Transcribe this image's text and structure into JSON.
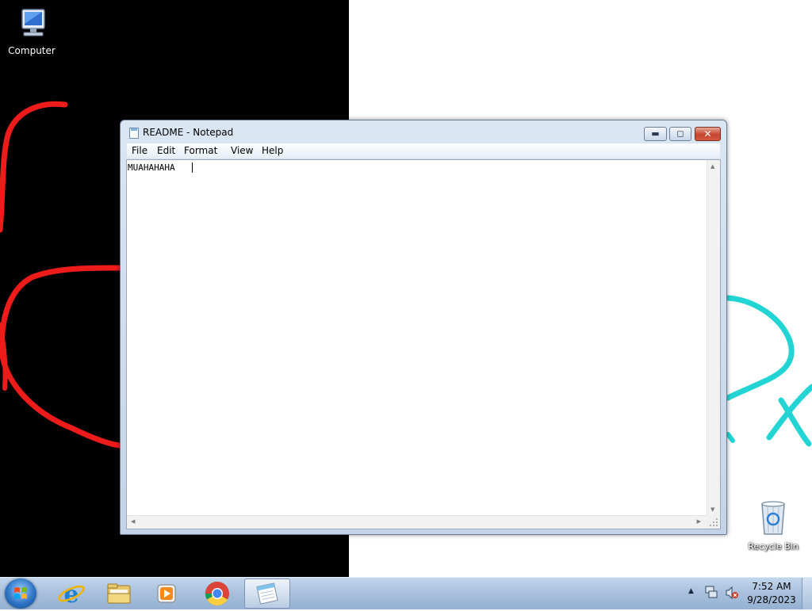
{
  "desktop": {
    "icons": [
      {
        "label": "Computer"
      },
      {
        "label": "Recycle Bin"
      }
    ],
    "colors": {
      "left_background": "#000000",
      "right_background": "#ffffff",
      "red_doodle": "#ee1b1b",
      "cyan_doodle": "#22d4d4"
    }
  },
  "notepad": {
    "title": "README - Notepad",
    "menu": [
      "File",
      "Edit",
      "Format",
      "View",
      "Help"
    ],
    "content": "MUAHAHAHA",
    "controls": {
      "minimize_icon": "minimize-icon",
      "maximize_icon": "maximize-icon",
      "close_icon": "close-icon",
      "close_glyph": "✕"
    }
  },
  "taskbar": {
    "start_icon": "windows-logo-icon",
    "pinned": [
      {
        "icon": "internet-explorer-icon"
      },
      {
        "icon": "folder-icon"
      },
      {
        "icon": "media-player-icon"
      },
      {
        "icon": "chrome-icon"
      },
      {
        "icon": "notepad-icon",
        "active": true
      }
    ],
    "tray": {
      "chevron": "▲",
      "network_icon": "network-icon",
      "volume_icon": "volume-muted-icon",
      "time": "7:52 AM",
      "date": "9/28/2023"
    }
  }
}
